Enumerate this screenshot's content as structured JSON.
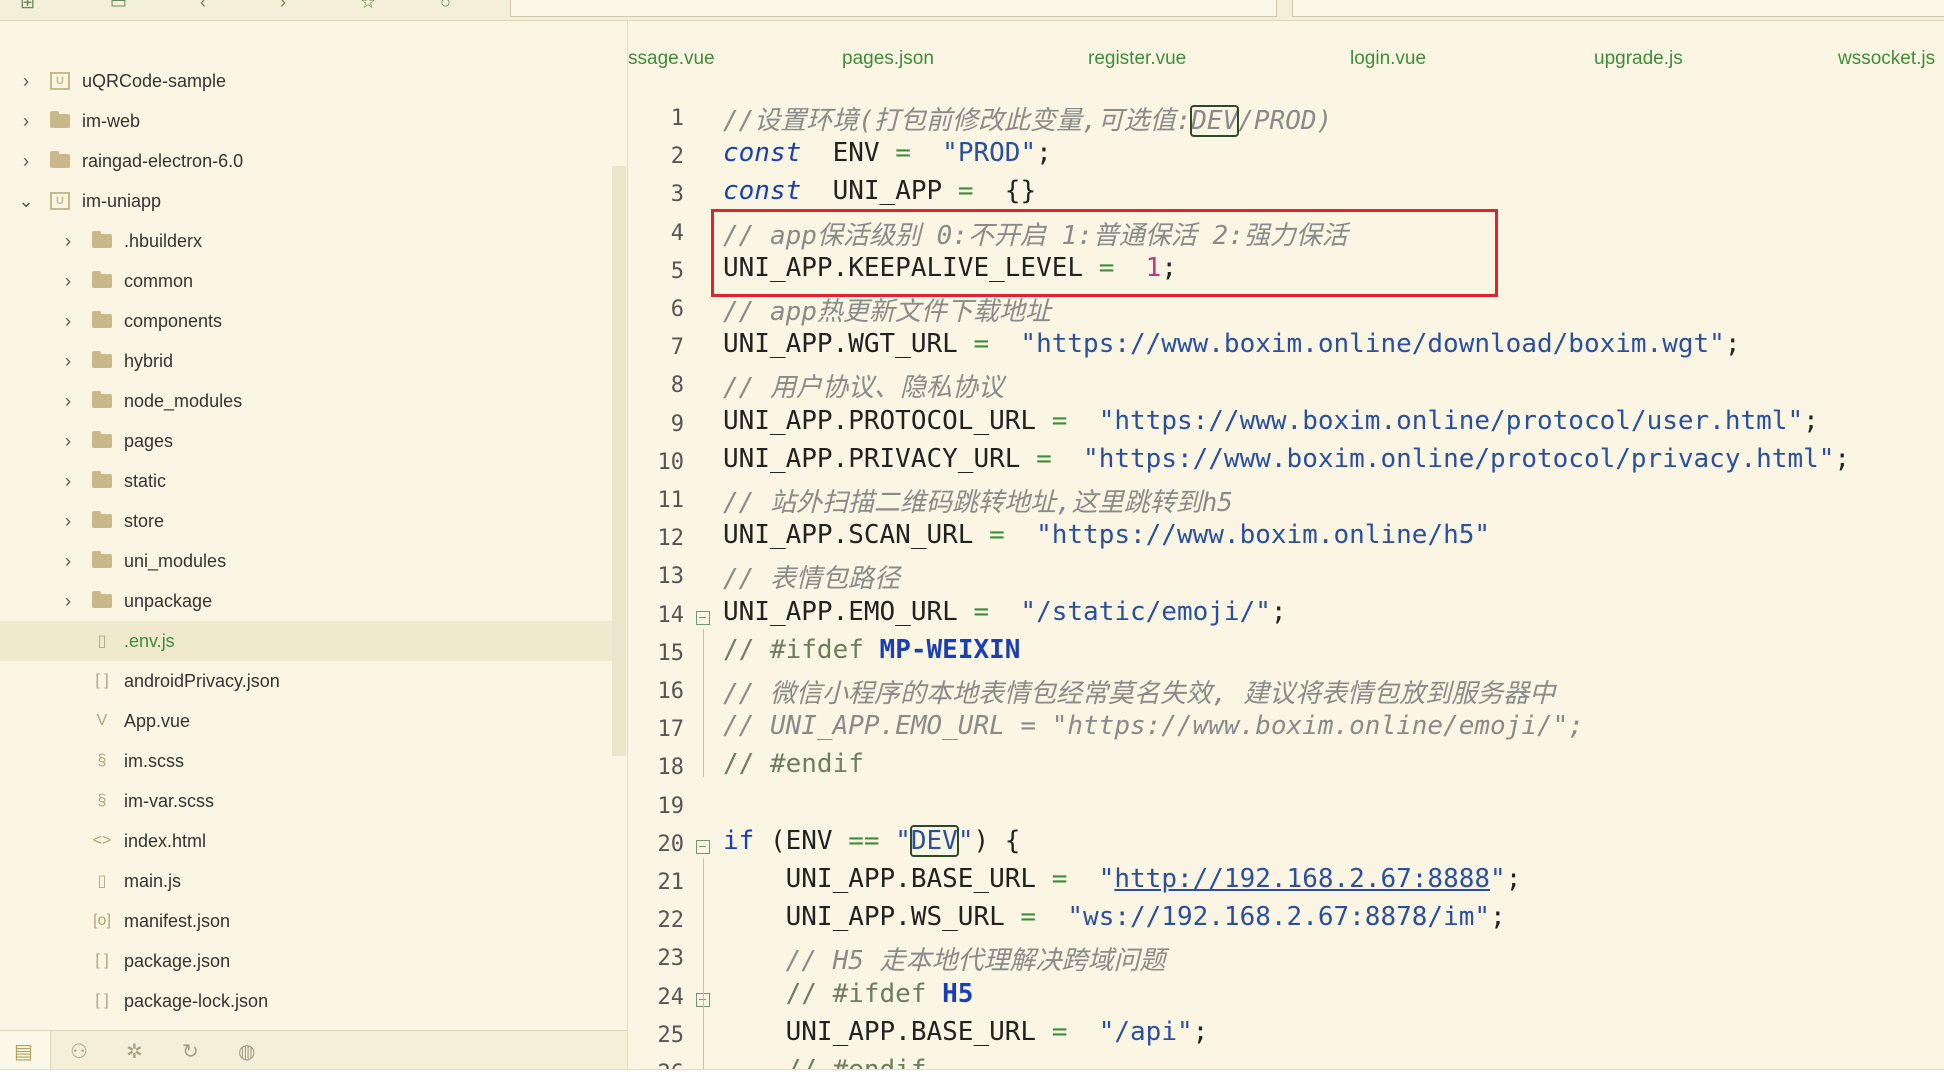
{
  "sidebar": {
    "items": [
      {
        "label": "uQRCode-sample",
        "kind": "project",
        "expand": "collapsed",
        "level": 0
      },
      {
        "label": "im-web",
        "kind": "folder",
        "expand": "collapsed",
        "level": 0
      },
      {
        "label": "raingad-electron-6.0",
        "kind": "folder",
        "expand": "collapsed",
        "level": 0
      },
      {
        "label": "im-uniapp",
        "kind": "project",
        "expand": "expanded",
        "level": 0
      },
      {
        "label": ".hbuilderx",
        "kind": "folder",
        "expand": "collapsed",
        "level": 1
      },
      {
        "label": "common",
        "kind": "folder",
        "expand": "collapsed",
        "level": 1
      },
      {
        "label": "components",
        "kind": "folder",
        "expand": "collapsed",
        "level": 1
      },
      {
        "label": "hybrid",
        "kind": "folder",
        "expand": "collapsed",
        "level": 1
      },
      {
        "label": "node_modules",
        "kind": "folder",
        "expand": "collapsed",
        "level": 1
      },
      {
        "label": "pages",
        "kind": "folder",
        "expand": "collapsed",
        "level": 1
      },
      {
        "label": "static",
        "kind": "folder",
        "expand": "collapsed",
        "level": 1
      },
      {
        "label": "store",
        "kind": "folder",
        "expand": "collapsed",
        "level": 1
      },
      {
        "label": "uni_modules",
        "kind": "folder",
        "expand": "collapsed",
        "level": 1
      },
      {
        "label": "unpackage",
        "kind": "folder",
        "expand": "collapsed",
        "level": 1
      },
      {
        "label": ".env.js",
        "kind": "file-js",
        "expand": "none",
        "level": 1,
        "selected": true
      },
      {
        "label": "androidPrivacy.json",
        "kind": "file-json",
        "expand": "none",
        "level": 1
      },
      {
        "label": "App.vue",
        "kind": "file-vue",
        "expand": "none",
        "level": 1
      },
      {
        "label": "im.scss",
        "kind": "file-scss",
        "expand": "none",
        "level": 1
      },
      {
        "label": "im-var.scss",
        "kind": "file-scss",
        "expand": "none",
        "level": 1
      },
      {
        "label": "index.html",
        "kind": "file-html",
        "expand": "none",
        "level": 1
      },
      {
        "label": "main.js",
        "kind": "file-js",
        "expand": "none",
        "level": 1
      },
      {
        "label": "manifest.json",
        "kind": "file-manifest",
        "expand": "none",
        "level": 1
      },
      {
        "label": "package.json",
        "kind": "file-json",
        "expand": "none",
        "level": 1
      },
      {
        "label": "package-lock.json",
        "kind": "file-json",
        "expand": "none",
        "level": 1
      }
    ],
    "bottom_icons": [
      "project-manager-icon",
      "plugin-icon",
      "debug-icon",
      "source-control-icon",
      "globe-icon"
    ]
  },
  "tabs": [
    "ssage.vue",
    "pages.json",
    "register.vue",
    "login.vue",
    "upgrade.js",
    "wssocket.js"
  ],
  "editor": {
    "lines": [
      {
        "n": "1",
        "tokens": [
          [
            "cm",
            "//设置环境(打包前修改此变量,可选值:"
          ],
          [
            "cm boxed",
            "DEV"
          ],
          [
            "cm",
            "/PROD)"
          ]
        ]
      },
      {
        "n": "2",
        "tokens": [
          [
            "kw",
            "const"
          ],
          [
            "",
            "  ENV "
          ],
          [
            "op",
            "="
          ],
          [
            "",
            "  "
          ],
          [
            "str",
            "\"PROD\""
          ],
          [
            "",
            ";"
          ]
        ]
      },
      {
        "n": "3",
        "tokens": [
          [
            "kw",
            "const"
          ],
          [
            "",
            "  UNI_APP "
          ],
          [
            "op",
            "="
          ],
          [
            "",
            "  {}"
          ]
        ]
      },
      {
        "n": "4",
        "tokens": [
          [
            "cm",
            "// app保活级别 0:不开启 1:普通保活 2:强力保活"
          ]
        ]
      },
      {
        "n": "5",
        "tokens": [
          [
            "",
            "UNI_APP.KEEPALIVE_LEVEL "
          ],
          [
            "op",
            "="
          ],
          [
            "",
            "  "
          ],
          [
            "num",
            "1"
          ],
          [
            "",
            ";"
          ]
        ]
      },
      {
        "n": "6",
        "tokens": [
          [
            "cm",
            "// app热更新文件下载地址"
          ]
        ]
      },
      {
        "n": "7",
        "tokens": [
          [
            "",
            "UNI_APP.WGT_URL "
          ],
          [
            "op",
            "="
          ],
          [
            "",
            "  "
          ],
          [
            "str",
            "\"https://www.boxim.online/download/boxim.wgt\""
          ],
          [
            "",
            ";"
          ]
        ]
      },
      {
        "n": "8",
        "tokens": [
          [
            "cm",
            "// 用户协议、隐私协议"
          ]
        ]
      },
      {
        "n": "9",
        "tokens": [
          [
            "",
            "UNI_APP.PROTOCOL_URL "
          ],
          [
            "op",
            "="
          ],
          [
            "",
            "  "
          ],
          [
            "str",
            "\"https://www.boxim.online/protocol/user.html\""
          ],
          [
            "",
            ";"
          ]
        ]
      },
      {
        "n": "10",
        "tokens": [
          [
            "",
            "UNI_APP.PRIVACY_URL "
          ],
          [
            "op",
            "="
          ],
          [
            "",
            "  "
          ],
          [
            "str",
            "\"https://www.boxim.online/protocol/privacy.html\""
          ],
          [
            "",
            ";"
          ]
        ]
      },
      {
        "n": "11",
        "tokens": [
          [
            "cm",
            "// 站外扫描二维码跳转地址,这里跳转到h5"
          ]
        ]
      },
      {
        "n": "12",
        "tokens": [
          [
            "",
            "UNI_APP.SCAN_URL "
          ],
          [
            "op",
            "="
          ],
          [
            "",
            "  "
          ],
          [
            "str",
            "\"https://www.boxim.online/h5\""
          ]
        ]
      },
      {
        "n": "13",
        "tokens": [
          [
            "cm",
            "// 表情包路径"
          ]
        ]
      },
      {
        "n": "14",
        "fold": true,
        "tokens": [
          [
            "",
            "UNI_APP.EMO_URL "
          ],
          [
            "op",
            "="
          ],
          [
            "",
            "  "
          ],
          [
            "str",
            "\"/static/emoji/\""
          ],
          [
            "",
            ";"
          ]
        ]
      },
      {
        "n": "15",
        "tokens": [
          [
            "cmd",
            "// #ifdef "
          ],
          [
            "pp",
            "MP-WEIXIN"
          ]
        ]
      },
      {
        "n": "16",
        "tokens": [
          [
            "cm",
            "// 微信小程序的本地表情包经常莫名失效, 建议将表情包放到服务器中"
          ]
        ]
      },
      {
        "n": "17",
        "tokens": [
          [
            "cm",
            "// UNI_APP.EMO_URL = \"https://www.boxim.online/emoji/\";"
          ]
        ]
      },
      {
        "n": "18",
        "tokens": [
          [
            "cmd",
            "// #endif"
          ]
        ]
      },
      {
        "n": "19",
        "tokens": []
      },
      {
        "n": "20",
        "fold": true,
        "tokens": [
          [
            "kw2",
            "if"
          ],
          [
            "",
            " (ENV "
          ],
          [
            "op",
            "=="
          ],
          [
            "",
            " "
          ],
          [
            "str",
            "\""
          ],
          [
            "str boxed",
            "DEV"
          ],
          [
            "str",
            "\""
          ],
          [
            "",
            ") {"
          ]
        ]
      },
      {
        "n": "21",
        "tokens": [
          [
            "",
            "    UNI_APP.BASE_URL "
          ],
          [
            "op",
            "="
          ],
          [
            "",
            "  "
          ],
          [
            "str",
            "\""
          ],
          [
            "link",
            "http://192.168.2.67:8888"
          ],
          [
            "str",
            "\""
          ],
          [
            "",
            ";"
          ]
        ]
      },
      {
        "n": "22",
        "tokens": [
          [
            "",
            "    UNI_APP.WS_URL "
          ],
          [
            "op",
            "="
          ],
          [
            "",
            "  "
          ],
          [
            "str",
            "\"ws://192.168.2.67:8878/im\""
          ],
          [
            "",
            ";"
          ]
        ]
      },
      {
        "n": "23",
        "tokens": [
          [
            "cm",
            "    // H5 走本地代理解决跨域问题"
          ]
        ]
      },
      {
        "n": "24",
        "fold": true,
        "tokens": [
          [
            "cmd",
            "    // #ifdef "
          ],
          [
            "pp",
            "H5"
          ]
        ]
      },
      {
        "n": "25",
        "tokens": [
          [
            "",
            "    UNI_APP.BASE_URL "
          ],
          [
            "op",
            "="
          ],
          [
            "",
            "  "
          ],
          [
            "str",
            "\"/api\""
          ],
          [
            "",
            ";"
          ]
        ]
      },
      {
        "n": "26",
        "tokens": [
          [
            "cmd",
            "    // #endif"
          ]
        ]
      }
    ]
  },
  "colors": {
    "highlight_box": "#e0242e",
    "background": "#faf6e3",
    "accent": "#3c8d3a"
  }
}
